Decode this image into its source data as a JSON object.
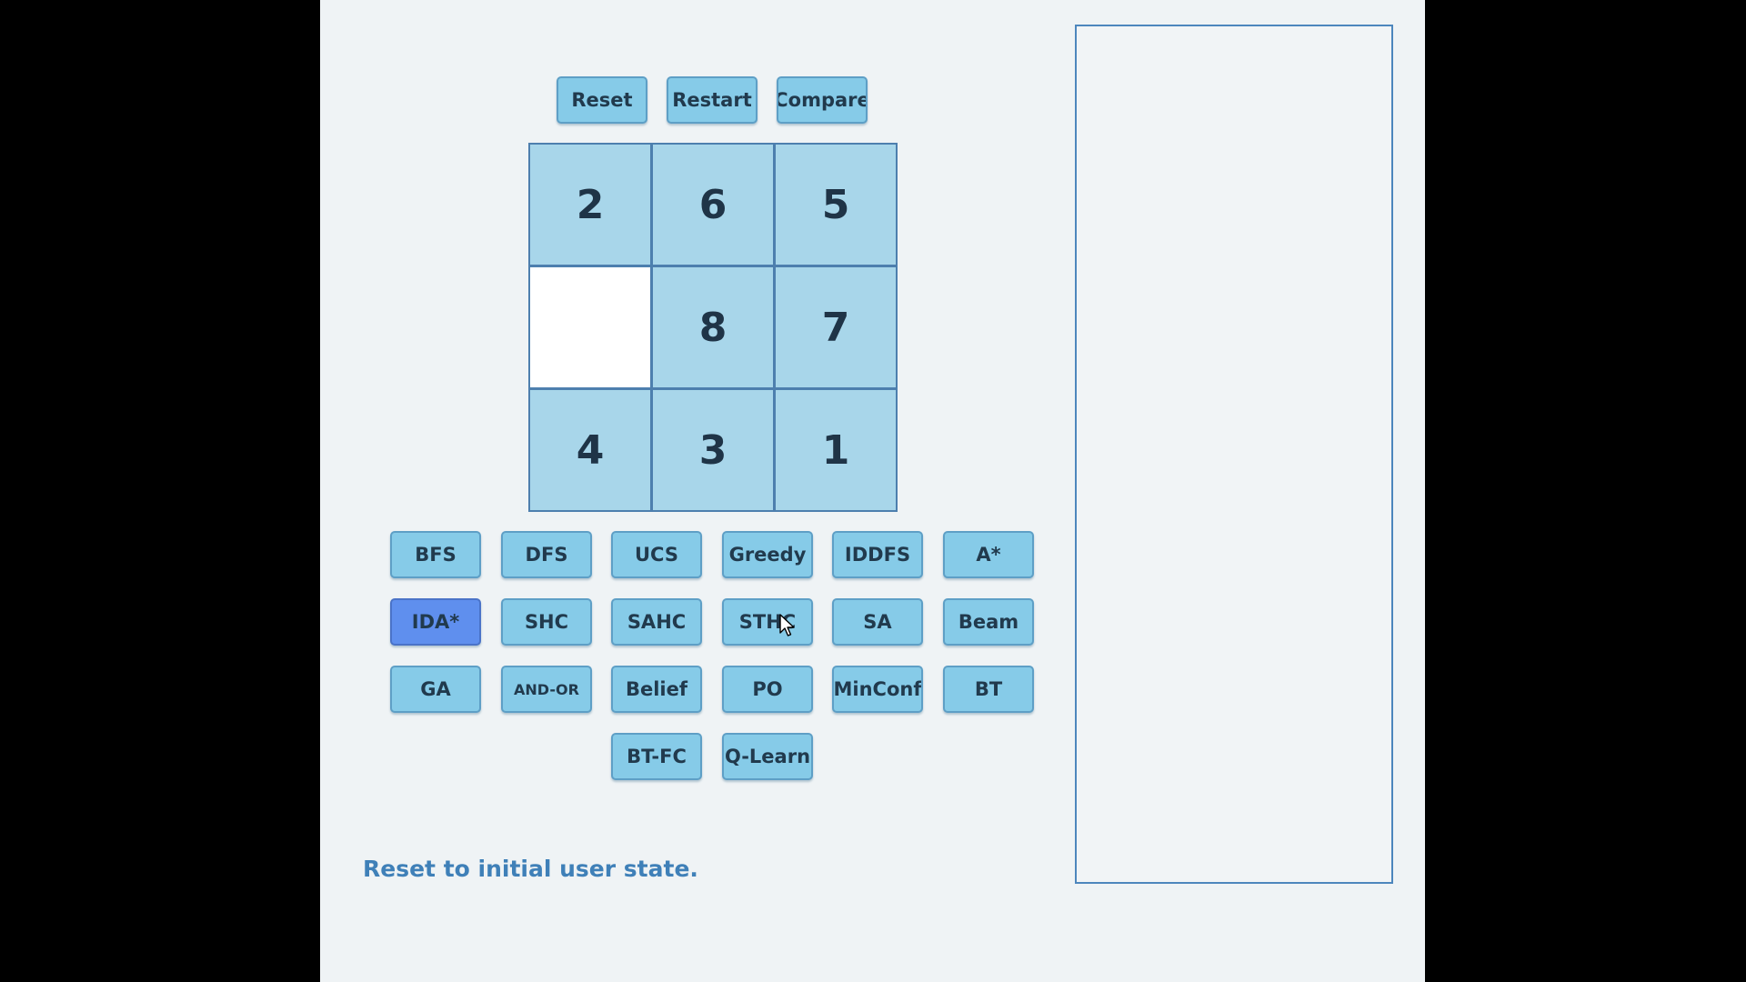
{
  "toolbar": {
    "reset_label": "Reset",
    "restart_label": "Restart",
    "compare_label": "Compare"
  },
  "puzzle": {
    "tiles": [
      "2",
      "6",
      "5",
      "",
      "8",
      "7",
      "4",
      "3",
      "1"
    ]
  },
  "algorithms": {
    "bfs": "BFS",
    "dfs": "DFS",
    "ucs": "UCS",
    "greedy": "Greedy",
    "iddfs": "IDDFS",
    "astar": "A*",
    "idastar": "IDA*",
    "shc": "SHC",
    "sahc": "SAHC",
    "sthc": "STHC",
    "sa": "SA",
    "beam": "Beam",
    "ga": "GA",
    "andor": "AND-OR",
    "belief": "Belief",
    "po": "PO",
    "minconf": "MinConf",
    "bt": "BT",
    "btfc": "BT-FC",
    "qlearn": "Q-Learn"
  },
  "status": {
    "message": "Reset to initial user state."
  },
  "colors": {
    "button": "#86cbe8",
    "button_active": "#5f8fee",
    "tile": "#a8d6ea",
    "status_text": "#3f80b8"
  }
}
